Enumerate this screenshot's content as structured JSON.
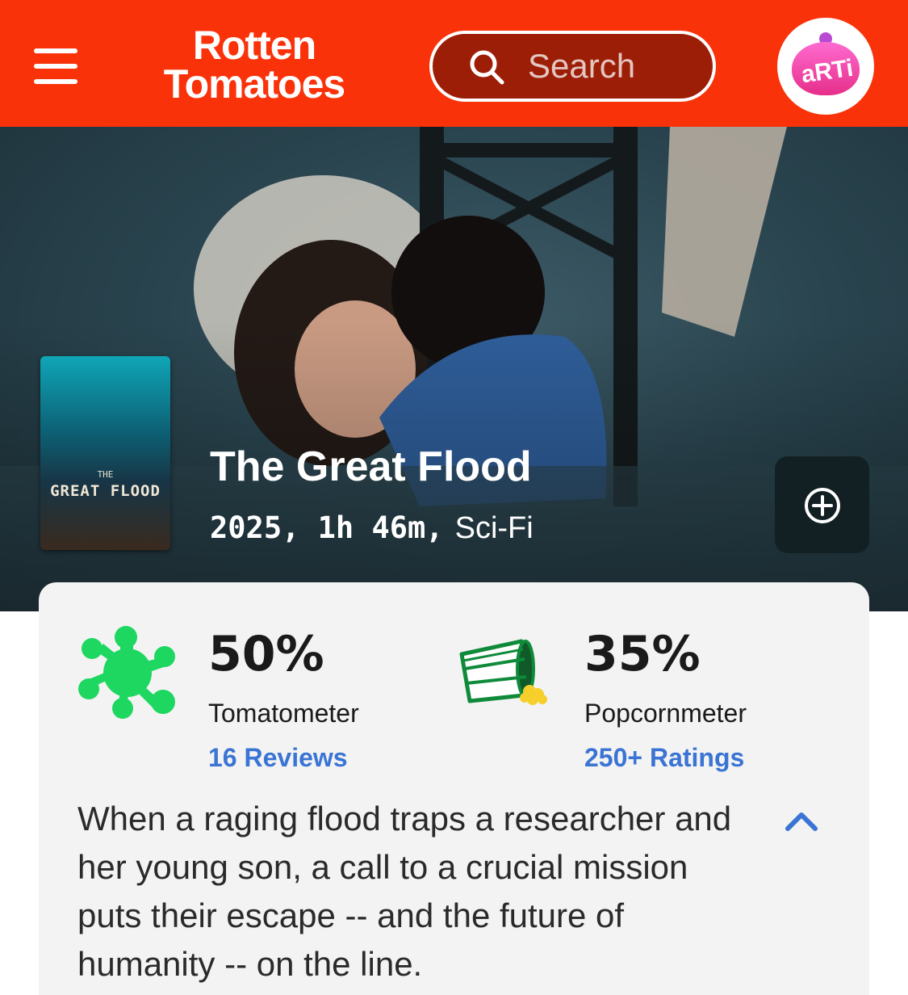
{
  "header": {
    "logo_line1": "Rotten",
    "logo_line2": "Tomatoes",
    "search_placeholder": "Search",
    "avatar_text": "aRTi",
    "brand_color": "#fa320a"
  },
  "movie": {
    "title": "The Great Flood",
    "year_runtime": "2025, 1h 46m,",
    "genre": "Sci-Fi",
    "poster_small_text": "THE",
    "poster_title": "GREAT FLOOD"
  },
  "scores": {
    "tomatometer": {
      "value": "50%",
      "label": "Tomatometer",
      "link": "16 Reviews",
      "icon": "rotten-splat-icon",
      "color": "#1ed760"
    },
    "popcornmeter": {
      "value": "35%",
      "label": "Popcornmeter",
      "link": "250+ Ratings",
      "icon": "spilled-popcorn-icon"
    }
  },
  "synopsis": "When a raging flood traps a researcher and her young son, a call to a crucial mission puts their escape -- and the future of humanity -- on the line."
}
